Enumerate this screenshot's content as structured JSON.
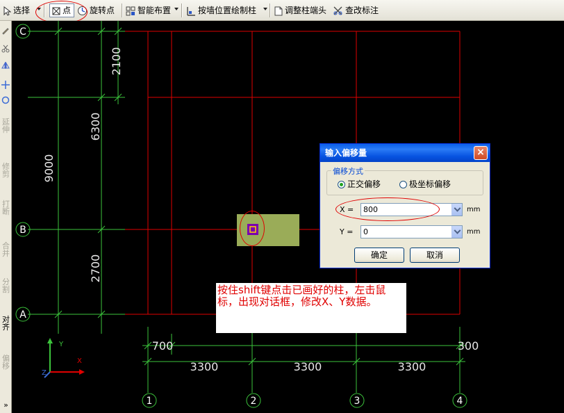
{
  "toolbar": {
    "select_label": "选择",
    "point_label": "点",
    "rotate_point_label": "旋转点",
    "smart_layout_label": "智能布置",
    "draw_by_wall_label": "按墙位置绘制柱",
    "adjust_column_end_label": "调整柱端头",
    "check_label_label": "查改标注"
  },
  "side_toolbar": {
    "extend": "延伸",
    "trim": "修剪",
    "break": "打断",
    "merge": "合并",
    "split": "分割",
    "align": "对齐",
    "offset": "偏移"
  },
  "canvas": {
    "axis_rows": [
      "C",
      "B",
      "A"
    ],
    "axis_cols": [
      "1",
      "2",
      "3",
      "4"
    ],
    "dimensions": {
      "left_total": "9000",
      "left_upper": "6300",
      "left_top": "2100",
      "left_lower": "2700",
      "bottom_left_offset": "700",
      "bottom_right_offset": "300",
      "span_1": "3300",
      "span_2": "3300",
      "span_3": "3300"
    },
    "ucs": {
      "y": "Y",
      "x": "X",
      "z": "Z"
    }
  },
  "dialog": {
    "title": "输入偏移量",
    "group_label": "偏移方式",
    "option_orthogonal": "正交偏移",
    "option_polar": "极坐标偏移",
    "x_label": "X =",
    "x_value": "800",
    "y_label": "Y =",
    "y_value": "0",
    "unit": "mm",
    "ok_label": "确定",
    "cancel_label": "取消"
  },
  "annotation": {
    "text": "按住shift键点击已画好的柱，左击鼠标，出现对话框，修改X、Y数据。"
  },
  "colors": {
    "grid_red": "#e00000",
    "dim_green": "#3cc43c",
    "column_fill": "#9aac58",
    "column_marker": "#7a00b0",
    "annotation_red": "#e00000"
  }
}
